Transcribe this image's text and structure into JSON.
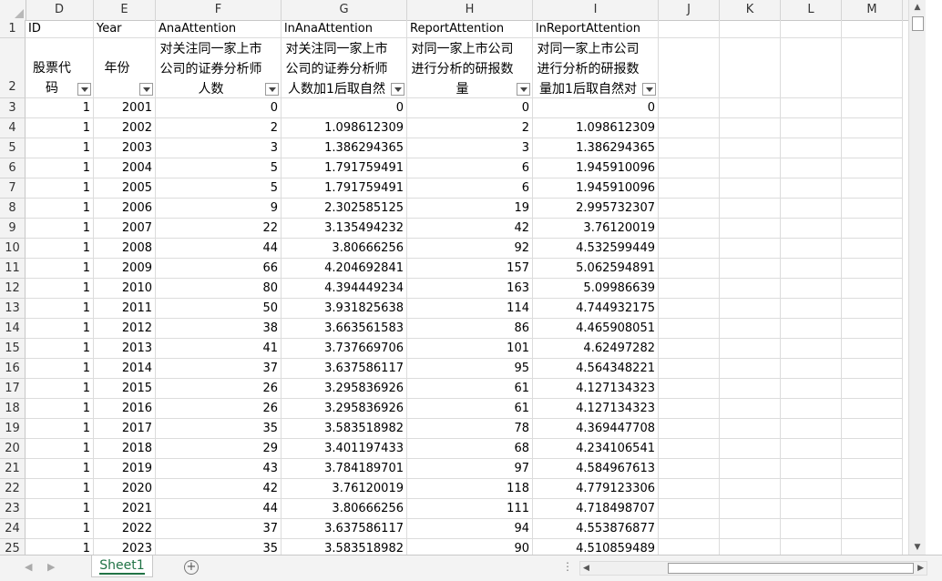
{
  "columns": [
    {
      "letter": "D",
      "align": "left"
    },
    {
      "letter": "E",
      "align": "left"
    },
    {
      "letter": "F",
      "align": "left"
    },
    {
      "letter": "G",
      "align": "left"
    },
    {
      "letter": "H",
      "align": "left"
    },
    {
      "letter": "I",
      "align": "left"
    },
    {
      "letter": "J",
      "align": "left"
    },
    {
      "letter": "K",
      "align": "left"
    },
    {
      "letter": "L",
      "align": "left"
    },
    {
      "letter": "M",
      "align": "left"
    }
  ],
  "row1": [
    "ID",
    "Year",
    "AnaAttention",
    "lnAnaAttention",
    "ReportAttention",
    "lnReportAttention",
    "",
    "",
    "",
    ""
  ],
  "row2": [
    "股票代码",
    "年份",
    "对关注同一家上市公司的证券分析师人数",
    "对关注同一家上市公司的证券分析师人数加1后取自然",
    "对同一家上市公司进行分析的研报数量",
    "对同一家上市公司进行分析的研报数量加1后取自然对",
    "",
    "",
    "",
    ""
  ],
  "rows": [
    {
      "n": "3",
      "c": [
        "1",
        "2001",
        "0",
        "0",
        "0",
        "0"
      ]
    },
    {
      "n": "4",
      "c": [
        "1",
        "2002",
        "2",
        "1.098612309",
        "2",
        "1.098612309"
      ]
    },
    {
      "n": "5",
      "c": [
        "1",
        "2003",
        "3",
        "1.386294365",
        "3",
        "1.386294365"
      ]
    },
    {
      "n": "6",
      "c": [
        "1",
        "2004",
        "5",
        "1.791759491",
        "6",
        "1.945910096"
      ]
    },
    {
      "n": "7",
      "c": [
        "1",
        "2005",
        "5",
        "1.791759491",
        "6",
        "1.945910096"
      ]
    },
    {
      "n": "8",
      "c": [
        "1",
        "2006",
        "9",
        "2.302585125",
        "19",
        "2.995732307"
      ]
    },
    {
      "n": "9",
      "c": [
        "1",
        "2007",
        "22",
        "3.135494232",
        "42",
        "3.76120019"
      ]
    },
    {
      "n": "10",
      "c": [
        "1",
        "2008",
        "44",
        "3.80666256",
        "92",
        "4.532599449"
      ]
    },
    {
      "n": "11",
      "c": [
        "1",
        "2009",
        "66",
        "4.204692841",
        "157",
        "5.062594891"
      ]
    },
    {
      "n": "12",
      "c": [
        "1",
        "2010",
        "80",
        "4.394449234",
        "163",
        "5.09986639"
      ]
    },
    {
      "n": "13",
      "c": [
        "1",
        "2011",
        "50",
        "3.931825638",
        "114",
        "4.744932175"
      ]
    },
    {
      "n": "14",
      "c": [
        "1",
        "2012",
        "38",
        "3.663561583",
        "86",
        "4.465908051"
      ]
    },
    {
      "n": "15",
      "c": [
        "1",
        "2013",
        "41",
        "3.737669706",
        "101",
        "4.62497282"
      ]
    },
    {
      "n": "16",
      "c": [
        "1",
        "2014",
        "37",
        "3.637586117",
        "95",
        "4.564348221"
      ]
    },
    {
      "n": "17",
      "c": [
        "1",
        "2015",
        "26",
        "3.295836926",
        "61",
        "4.127134323"
      ]
    },
    {
      "n": "18",
      "c": [
        "1",
        "2016",
        "26",
        "3.295836926",
        "61",
        "4.127134323"
      ]
    },
    {
      "n": "19",
      "c": [
        "1",
        "2017",
        "35",
        "3.583518982",
        "78",
        "4.369447708"
      ]
    },
    {
      "n": "20",
      "c": [
        "1",
        "2018",
        "29",
        "3.401197433",
        "68",
        "4.234106541"
      ]
    },
    {
      "n": "21",
      "c": [
        "1",
        "2019",
        "43",
        "3.784189701",
        "97",
        "4.584967613"
      ]
    },
    {
      "n": "22",
      "c": [
        "1",
        "2020",
        "42",
        "3.76120019",
        "118",
        "4.779123306"
      ]
    },
    {
      "n": "23",
      "c": [
        "1",
        "2021",
        "44",
        "3.80666256",
        "111",
        "4.718498707"
      ]
    },
    {
      "n": "24",
      "c": [
        "1",
        "2022",
        "37",
        "3.637586117",
        "94",
        "4.553876877"
      ]
    },
    {
      "n": "25",
      "c": [
        "1",
        "2023",
        "35",
        "3.583518982",
        "90",
        "4.510859489"
      ]
    }
  ],
  "row_labels_top": [
    "1",
    "2"
  ],
  "sheet_tab": "Sheet1",
  "add_sheet_symbol": "+",
  "nav_prev": "◀",
  "nav_next": "▶",
  "dots": "⋮",
  "accent": "#217346"
}
